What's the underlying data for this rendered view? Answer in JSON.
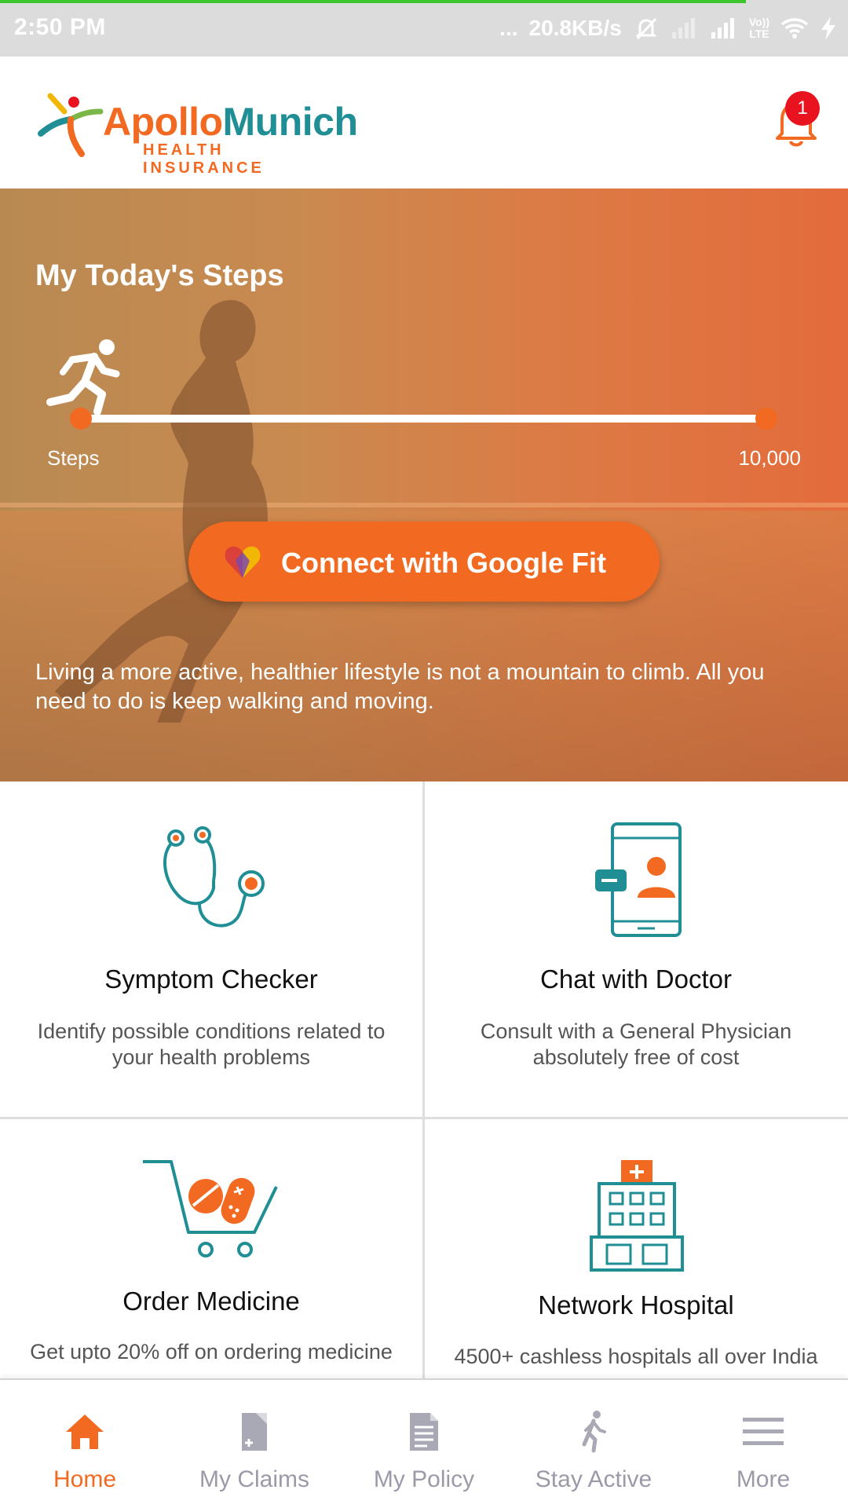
{
  "status_bar": {
    "time": "2:50 PM",
    "dots": "...",
    "net_speed": "20.8KB/s",
    "network_badge_line1": "Vo))",
    "network_badge_line2": "LTE"
  },
  "header": {
    "logo_part1": "Apollo",
    "logo_part2": "Munich",
    "logo_sub": "HEALTH INSURANCE",
    "notification_count": "1"
  },
  "hero": {
    "title": "My Today's Steps",
    "steps_label": "Steps",
    "steps_max": "10,000",
    "steps_progress": 0,
    "connect_button": "Connect with Google Fit",
    "description": "Living a more active, healthier lifestyle is not a mountain to climb. All you need to do is keep walking and moving."
  },
  "cards": [
    {
      "title": "Symptom Checker",
      "desc": "Identify possible conditions related to your health problems",
      "icon": "stethoscope-icon"
    },
    {
      "title": "Chat with Doctor",
      "desc": "Consult with a General Physician absolutely free of cost",
      "icon": "phone-doctor-icon"
    },
    {
      "title": "Order Medicine",
      "desc": "Get upto 20% off on ordering medicine",
      "icon": "medicine-cart-icon"
    },
    {
      "title": "Network Hospital",
      "desc": "4500+ cashless hospitals all over India",
      "icon": "hospital-icon"
    }
  ],
  "nav": [
    {
      "label": "Home",
      "icon": "home-icon",
      "active": true
    },
    {
      "label": "My Claims",
      "icon": "claims-icon",
      "active": false
    },
    {
      "label": "My Policy",
      "icon": "policy-document-icon",
      "active": false
    },
    {
      "label": "Stay Active",
      "icon": "walking-icon",
      "active": false
    },
    {
      "label": "More",
      "icon": "menu-icon",
      "active": false
    }
  ],
  "colors": {
    "accent": "#f26a21",
    "teal": "#1f8f95",
    "badge": "#e8131e",
    "nav_inactive": "#9a9aa8"
  }
}
